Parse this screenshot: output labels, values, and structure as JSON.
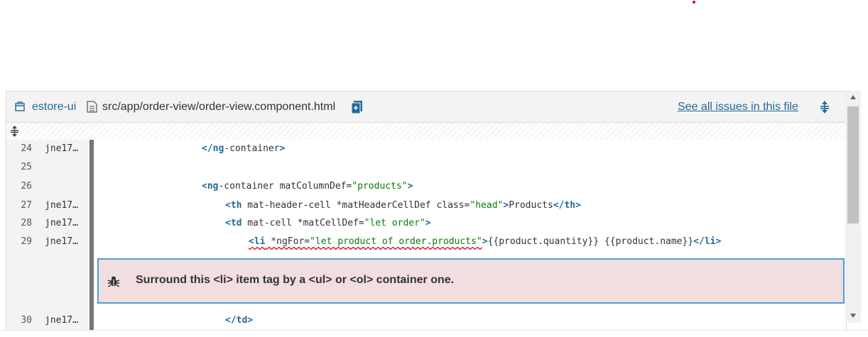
{
  "header": {
    "project_name": "estore-ui",
    "file_path": "src/app/order-view/order-view.component.html",
    "see_all_label": "See all issues in this file",
    "project_icon": "project-icon",
    "file_icon": "file-icon",
    "copy_icon": "copy-path-icon",
    "expand_icon": "expand-icon"
  },
  "lines": [
    {
      "number": "24",
      "author": "jne17…",
      "tag1": "</ng",
      "text1": "-container",
      "tag2": ">"
    },
    {
      "number": "25",
      "author": ""
    },
    {
      "number": "26",
      "author": "",
      "tag1": "<ng",
      "text1": "-container matColumnDef=",
      "str1": "\"products\"",
      "tag2": ">"
    },
    {
      "number": "27",
      "author": "jne17…",
      "tag1": "<th",
      "text1": " mat-header-cell *matHeaderCellDef class=",
      "str1": "\"head\"",
      "tag2": ">",
      "text2": "Products",
      "tag3": "</th>"
    },
    {
      "number": "28",
      "author": "jne17…",
      "tag1": "<td",
      "text1": " mat-cell *matCellDef=",
      "str1": "\"let order\"",
      "tag2": ">"
    },
    {
      "number": "29",
      "author": "jne17…",
      "tag1": "<li",
      "text1": " *ngFor=",
      "str1": "\"let product of order.products\"",
      "tag2": ">",
      "text2": "{{product.quantity}} {{product.name}}",
      "tag3": "</li>"
    },
    {
      "number": "30",
      "author": "jne17…",
      "tag1": "</td>"
    }
  ],
  "issue": {
    "message": "Surround this <li> item tag by a <ul> or <ol> container one.",
    "icon": "bug-icon"
  },
  "colors": {
    "link": "#236a97",
    "issue_background": "#f2dede",
    "issue_border": "#4b9fd5",
    "squiggle": "#d0021b"
  }
}
